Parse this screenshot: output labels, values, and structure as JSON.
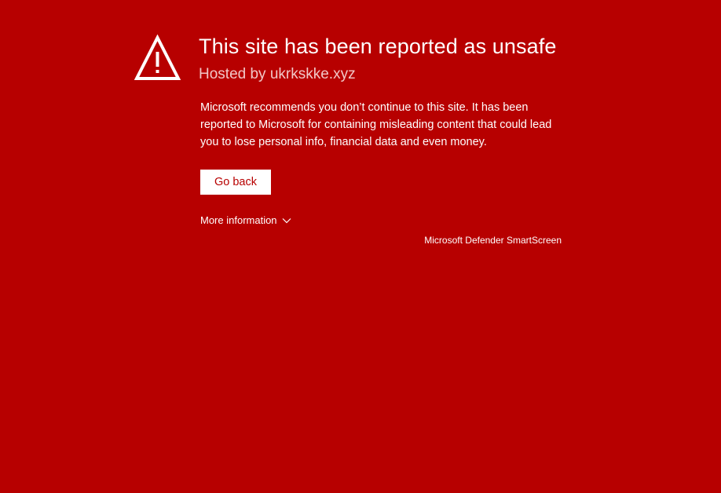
{
  "page": {
    "background_color": "#b70000"
  },
  "warning": {
    "icon": "warning-triangle-icon",
    "title": "This site has been reported as unsafe",
    "host": "Hosted by ukrkskke.xyz",
    "message": "Microsoft recommends you don’t continue to this site. It has been reported to Microsoft for containing misleading content that could lead you to lose personal info, financial data and even money."
  },
  "actions": {
    "go_back_label": "Go back",
    "more_info_label": "More information",
    "more_info_icon": "chevron-down-icon"
  },
  "footer": {
    "product_name": "Microsoft Defender SmartScreen"
  }
}
